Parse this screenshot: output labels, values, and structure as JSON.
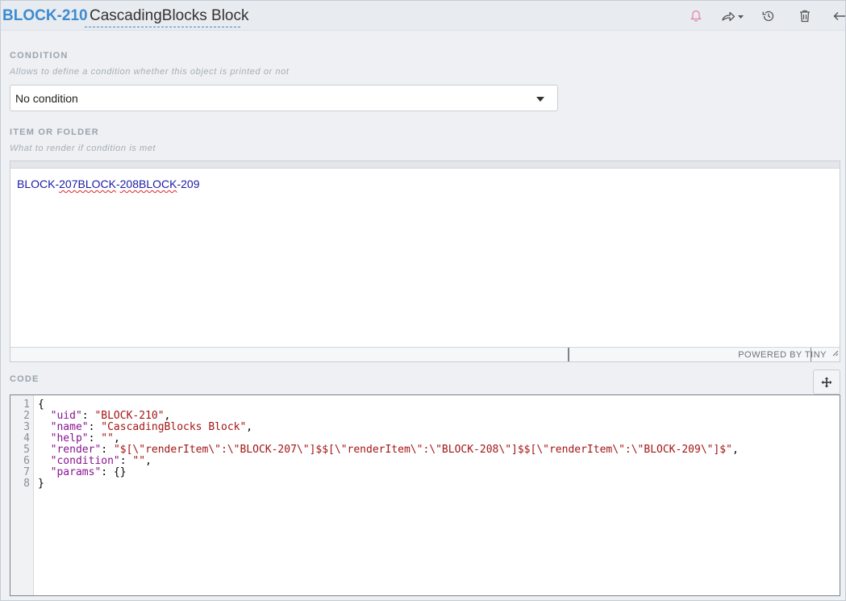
{
  "header": {
    "uid": "BLOCK-210",
    "name": "CascadingBlocks Block",
    "icons": [
      "bell-icon",
      "share-icon",
      "history-icon",
      "trash-icon",
      "back-arrow-icon"
    ]
  },
  "condition": {
    "title": "CONDITION",
    "help": "Allows to define a condition whether this object is printed or not",
    "selected": "No condition"
  },
  "item": {
    "title": "ITEM OR FOLDER",
    "help": "What to render if condition is met",
    "content_parts": [
      "BLOCK-",
      "207BLOCK",
      "-",
      "208BLOCK",
      "-209"
    ],
    "powered_by": "POWERED BY TINY"
  },
  "code": {
    "title": "CODE",
    "line_numbers": [
      "1",
      "2",
      "3",
      "4",
      "5",
      "6",
      "7",
      "8"
    ],
    "lines": [
      "{",
      "  \"uid\": \"BLOCK-210\",",
      "  \"name\": \"CascadingBlocks Block\",",
      "  \"help\": \"\",",
      "  \"render\": \"$[\\\"renderItem\\\":\\\"BLOCK-207\\\"]$$[\\\"renderItem\\\":\\\"BLOCK-208\\\"]$$[\\\"renderItem\\\":\\\"BLOCK-209\\\"]$\",",
      "  \"condition\": \"\",",
      "  \"params\": {}",
      "}"
    ]
  },
  "colors": {
    "accent": "#3d8bd1",
    "bell": "#e57fa5",
    "string": "#a31515",
    "key": "#881391"
  }
}
